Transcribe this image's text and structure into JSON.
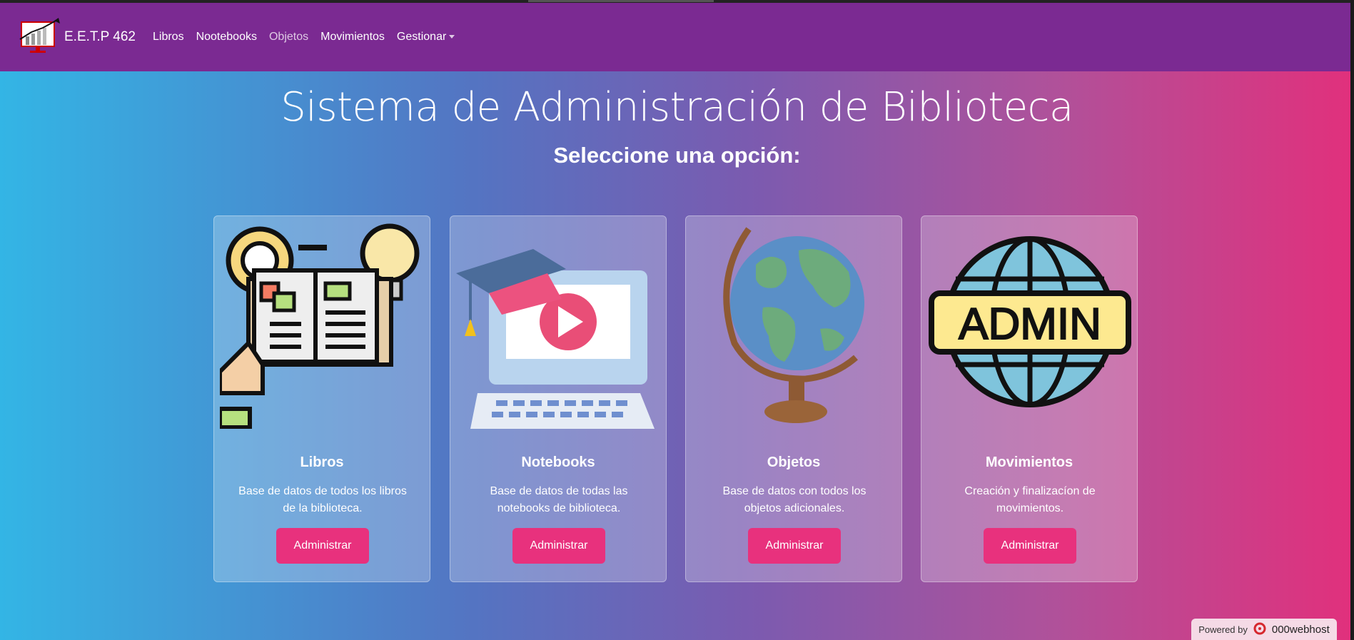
{
  "navbar": {
    "brand": "E.E.T.P 462",
    "links": [
      "Libros",
      "Nootebooks",
      "Objetos",
      "Movimientos"
    ],
    "dropdown_label": "Gestionar"
  },
  "page": {
    "title": "Sistema de Administración de Biblioteca",
    "subtitle": "Seleccione una opción:"
  },
  "cards": [
    {
      "title": "Libros",
      "description": "Base de datos de todos los libros de la biblioteca.",
      "button": "Administrar",
      "icon": "book-ideas-icon"
    },
    {
      "title": "Notebooks",
      "description": "Base de datos de todas las notebooks de biblioteca.",
      "button": "Administrar",
      "icon": "laptop-graduation-icon"
    },
    {
      "title": "Objetos",
      "description": "Base de datos con todos los objetos adicionales.",
      "button": "Administrar",
      "icon": "globe-icon"
    },
    {
      "title": "Movimientos",
      "description": "Creación y finalizacíon de movimientos.",
      "button": "Administrar",
      "icon": "admin-globe-icon"
    }
  ],
  "footer": {
    "powered_by": "Powered by",
    "host": "000webhost"
  },
  "colors": {
    "navbar": "#7b2a92",
    "button": "#e8317d",
    "gradient_start": "#33b5e5",
    "gradient_end": "#e1307c"
  }
}
